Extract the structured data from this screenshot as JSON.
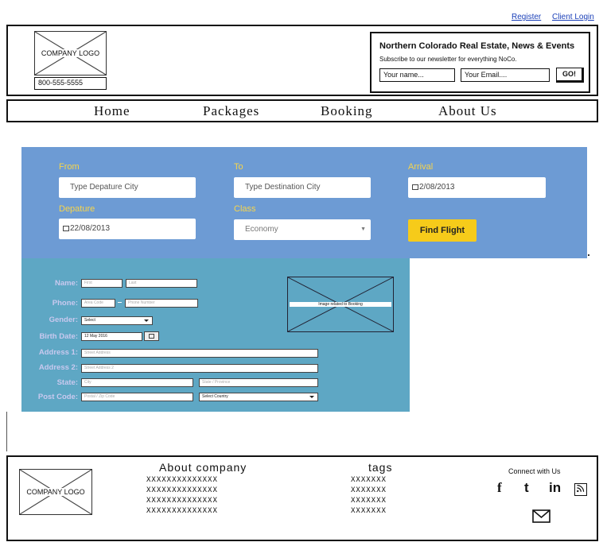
{
  "top_links": {
    "register": "Register",
    "client_login": "Client Login"
  },
  "header": {
    "logo_text": "COMPANY LOGO",
    "phone": "800-555-5555",
    "newsletter": {
      "title": "Northern Colorado Real Estate, News & Events",
      "subtitle": "Subscribe to our newsletter for everything NoCo.",
      "name_placeholder": "Your name...",
      "email_placeholder": "Your Email....",
      "go_label": "GO!"
    }
  },
  "nav": {
    "items": [
      "Home",
      "Packages",
      "Booking",
      "About Us"
    ]
  },
  "flight": {
    "from_label": "From",
    "from_placeholder": "Type Depature City",
    "to_label": "To",
    "to_placeholder": "Type Destination City",
    "arrival_label": "Arrival",
    "arrival_value": "2/08/2013",
    "departure_label": "Depature",
    "departure_value": "22/08/2013",
    "class_label": "Class",
    "class_value": "Economy",
    "find_label": "Find Flight"
  },
  "personal": {
    "name_label": "Name:",
    "first_ph": "First",
    "last_ph": "Last",
    "phone_label": "Phone:",
    "area_ph": "Area Code",
    "phone_ph": "Phone Number",
    "gender_label": "Gender:",
    "gender_value": "Select",
    "birth_label": "Birth Date:",
    "birth_value": "12 May 2016",
    "address1_label": "Address 1:",
    "address1_ph": "Street Address",
    "address2_label": "Address 2:",
    "address2_ph": "Street Address 2",
    "state_label": "State:",
    "city_ph": "City",
    "state_ph": "State / Province",
    "postcode_label": "Post Code:",
    "postcode_ph": "Postal / Zip Code",
    "country_value": "Select Country",
    "image_label": "Image related to Booking"
  },
  "footer": {
    "logo_text": "COMPANY LOGO",
    "about_title": "About company",
    "about_lines": [
      "XXXXXXXXXXXXXX",
      "XXXXXXXXXXXXXX",
      "XXXXXXXXXXXXXX",
      "XXXXXXXXXXXXXX"
    ],
    "tags_title": "tags",
    "tags_lines": [
      "XXXXXXX",
      "XXXXXXX",
      "XXXXXXX",
      "XXXXXXX"
    ],
    "connect_label": "Connect with Us",
    "social": {
      "facebook": "f",
      "twitter": "t",
      "linkedin": "in"
    }
  }
}
